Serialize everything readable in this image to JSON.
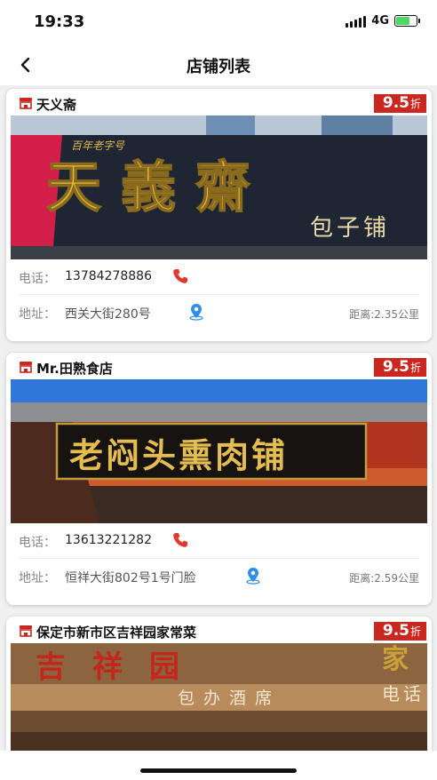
{
  "status_bar": {
    "time": "19:33",
    "network": "4G",
    "battery_level": 0.7
  },
  "nav": {
    "title": "店铺列表",
    "back_icon": "chevron-left-icon"
  },
  "labels": {
    "phone": "电话：",
    "address": "地址："
  },
  "stores": [
    {
      "name": "天义斋",
      "discount": "9.5",
      "discount_unit": "折",
      "phone": "13784278886",
      "address": "西关大街280号",
      "distance": "距离:2.35公里",
      "sign": {
        "top_text": "百年老字号",
        "main_text": "天義齋",
        "sub_text": "包子铺"
      }
    },
    {
      "name": "Mr.田熟食店",
      "discount": "9.5",
      "discount_unit": "折",
      "phone": "13613221282",
      "address": "恒祥大街802号1号门脸",
      "distance": "距离:2.59公里",
      "sign": {
        "main_text": "老闷头熏肉铺"
      }
    },
    {
      "name": "保定市新市区吉祥园家常菜",
      "discount": "9.5",
      "discount_unit": "折",
      "sign": {
        "main_text": "吉祥园",
        "side_text": "家",
        "sub_text": "包办酒席",
        "side_sub": "电话"
      }
    }
  ],
  "colors": {
    "accent": "#c9271f",
    "phone_icon": "#e0392f",
    "location_icon": "#2f8fe8"
  }
}
